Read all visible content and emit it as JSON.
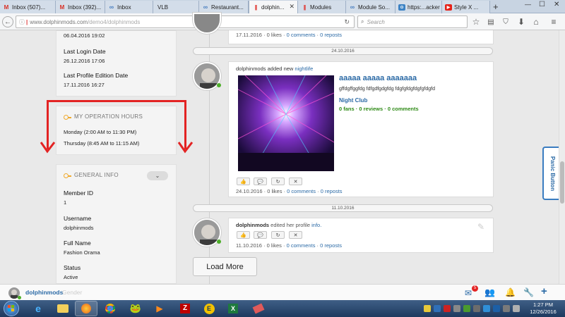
{
  "browser": {
    "tabs": [
      {
        "label": "Inbox (507)...",
        "icon": "gmail-icon"
      },
      {
        "label": "Inbox (392)...",
        "icon": "gmail-icon"
      },
      {
        "label": "Inbox",
        "icon": "loop-icon"
      },
      {
        "label": "VLB",
        "icon": ""
      },
      {
        "label": "Restaurant...",
        "icon": "loop-icon"
      },
      {
        "label": "dolphin...",
        "icon": "bars-icon"
      },
      {
        "label": "Modules",
        "icon": "bars-icon"
      },
      {
        "label": "Module So...",
        "icon": "loop-icon"
      },
      {
        "label": "https:...acker",
        "icon": "ext-icon"
      },
      {
        "label": "Style X ...",
        "icon": "youtube-icon"
      }
    ],
    "url_host": "www.dolphinmods.com",
    "url_path": "/demo4/dolphinmods",
    "search_placeholder": "Search"
  },
  "profile": {
    "created_value": "06.04.2016 19:02",
    "last_login_label": "Last Login Date",
    "last_login_value": "26.12.2016 17:06",
    "last_edit_label": "Last Profile Edition Date",
    "last_edit_value": "17.11.2016 16:27",
    "hours_title": "MY OPERATION HOURS",
    "hours": [
      "Monday (2:00 AM to 11:30 PM)",
      "Thursday (8:45 AM to 11:15 AM)"
    ],
    "general_title": "GENERAL INFO",
    "fields": [
      {
        "label": "Member ID",
        "value": "1"
      },
      {
        "label": "Username",
        "value": "dolphinmods"
      },
      {
        "label": "Full Name",
        "value": "Fashion Orama"
      },
      {
        "label": "Status",
        "value": "Active"
      }
    ]
  },
  "timeline": {
    "top_meta": {
      "date": "17.11.2016",
      "likes": "0 likes",
      "comments": "0 comments",
      "reposts": "0 reposts"
    },
    "date1": "24.10.2016",
    "post1": {
      "author": "dolphinmods",
      "action": "added new",
      "link": "nightlife",
      "title": "aaaaa aaaaa aaaaaaa",
      "desc": "gffdgffggfdg fdfgdfgdgfdg fdgfgfdgfdgfgfdgfd",
      "category": "Night Club",
      "fans": "0 fans",
      "reviews": "0 reviews",
      "comments_count": "0 comments",
      "date": "24.10.2016",
      "likes": "0 likes",
      "comments": "0 comments",
      "reposts": "0 reposts"
    },
    "date2": "11.10.2016",
    "post2": {
      "author": "dolphinmods",
      "action": "edited her profile",
      "link": "info.",
      "date": "11.10.2016",
      "likes": "0 likes",
      "comments": "0 comments",
      "reposts": "0 reposts"
    },
    "load_more": "Load More"
  },
  "panic_label": "Panic Button",
  "member_bar": {
    "username": "dolphinmods",
    "sub": "Gender",
    "mail_badge": "5"
  },
  "taskbar": {
    "time": "1:27 PM",
    "date": "12/26/2016"
  },
  "colors": {
    "link": "#2b6aa6",
    "annotation": "#e32323",
    "online": "#4cae29"
  }
}
